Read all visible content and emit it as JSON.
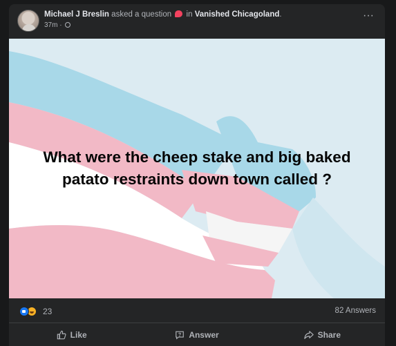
{
  "post": {
    "author": "Michael J Breslin",
    "action_text": "asked a question",
    "in_text": "in",
    "group": "Vanished Chicagoland",
    "period": ".",
    "time": "37m",
    "time_separator": "·",
    "question": "What were the cheep stake and big baked patato restraints down town called ?",
    "question_line1": "What were the cheep stake and big baked",
    "question_line2": "patato restraints down town called ?"
  },
  "stats": {
    "reaction_count": "23",
    "answers_count": "82 Answers"
  },
  "actions": {
    "like_label": "Like",
    "answer_label": "Answer",
    "share_label": "Share"
  },
  "colors": {
    "background": "#18191a",
    "card": "#242526",
    "flag_blue": "#a8d8e8",
    "flag_pink": "#f2b9c6",
    "flag_white": "#ffffff",
    "question_badge": "#f3425f",
    "like_blue": "#1877f2"
  },
  "icons": [
    "avatar",
    "question-badge-icon",
    "globe-icon",
    "more-options-icon",
    "like-reaction-icon",
    "haha-reaction-icon",
    "like-icon",
    "answer-icon",
    "share-icon"
  ]
}
